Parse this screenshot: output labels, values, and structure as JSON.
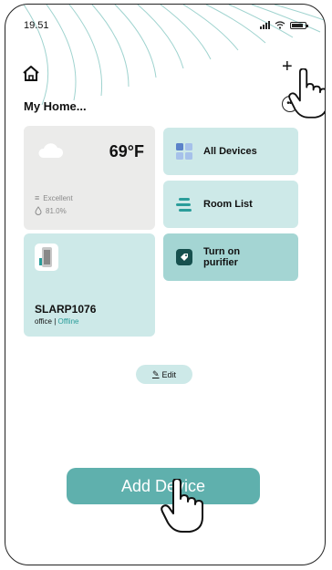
{
  "status_bar": {
    "time": "19.51"
  },
  "header": {
    "title": "My Home...",
    "add_icon": "plus-icon",
    "more_icon": "more-icon",
    "home_icon": "home-icon"
  },
  "weather": {
    "temperature": "69°F",
    "air_quality": "Excellent",
    "humidity": "81.0%",
    "icon": "cloud-icon"
  },
  "actions": [
    {
      "label": "All Devices",
      "icon": "grid-icon"
    },
    {
      "label": "Room List",
      "icon": "list-icon"
    },
    {
      "label": "Turn on\npurifier",
      "icon": "tag-icon"
    }
  ],
  "device": {
    "name": "SLARP1076",
    "room": "office | ",
    "status": "Offline",
    "icon": "air-purifier-icon"
  },
  "edit": {
    "label": "Edit"
  },
  "add_device": {
    "label": "Add Device"
  },
  "colors": {
    "accent": "#5fb0ad",
    "tile": "#cde9e8",
    "tile_dark": "#a4d5d3",
    "weather_bg": "#ebebea"
  }
}
